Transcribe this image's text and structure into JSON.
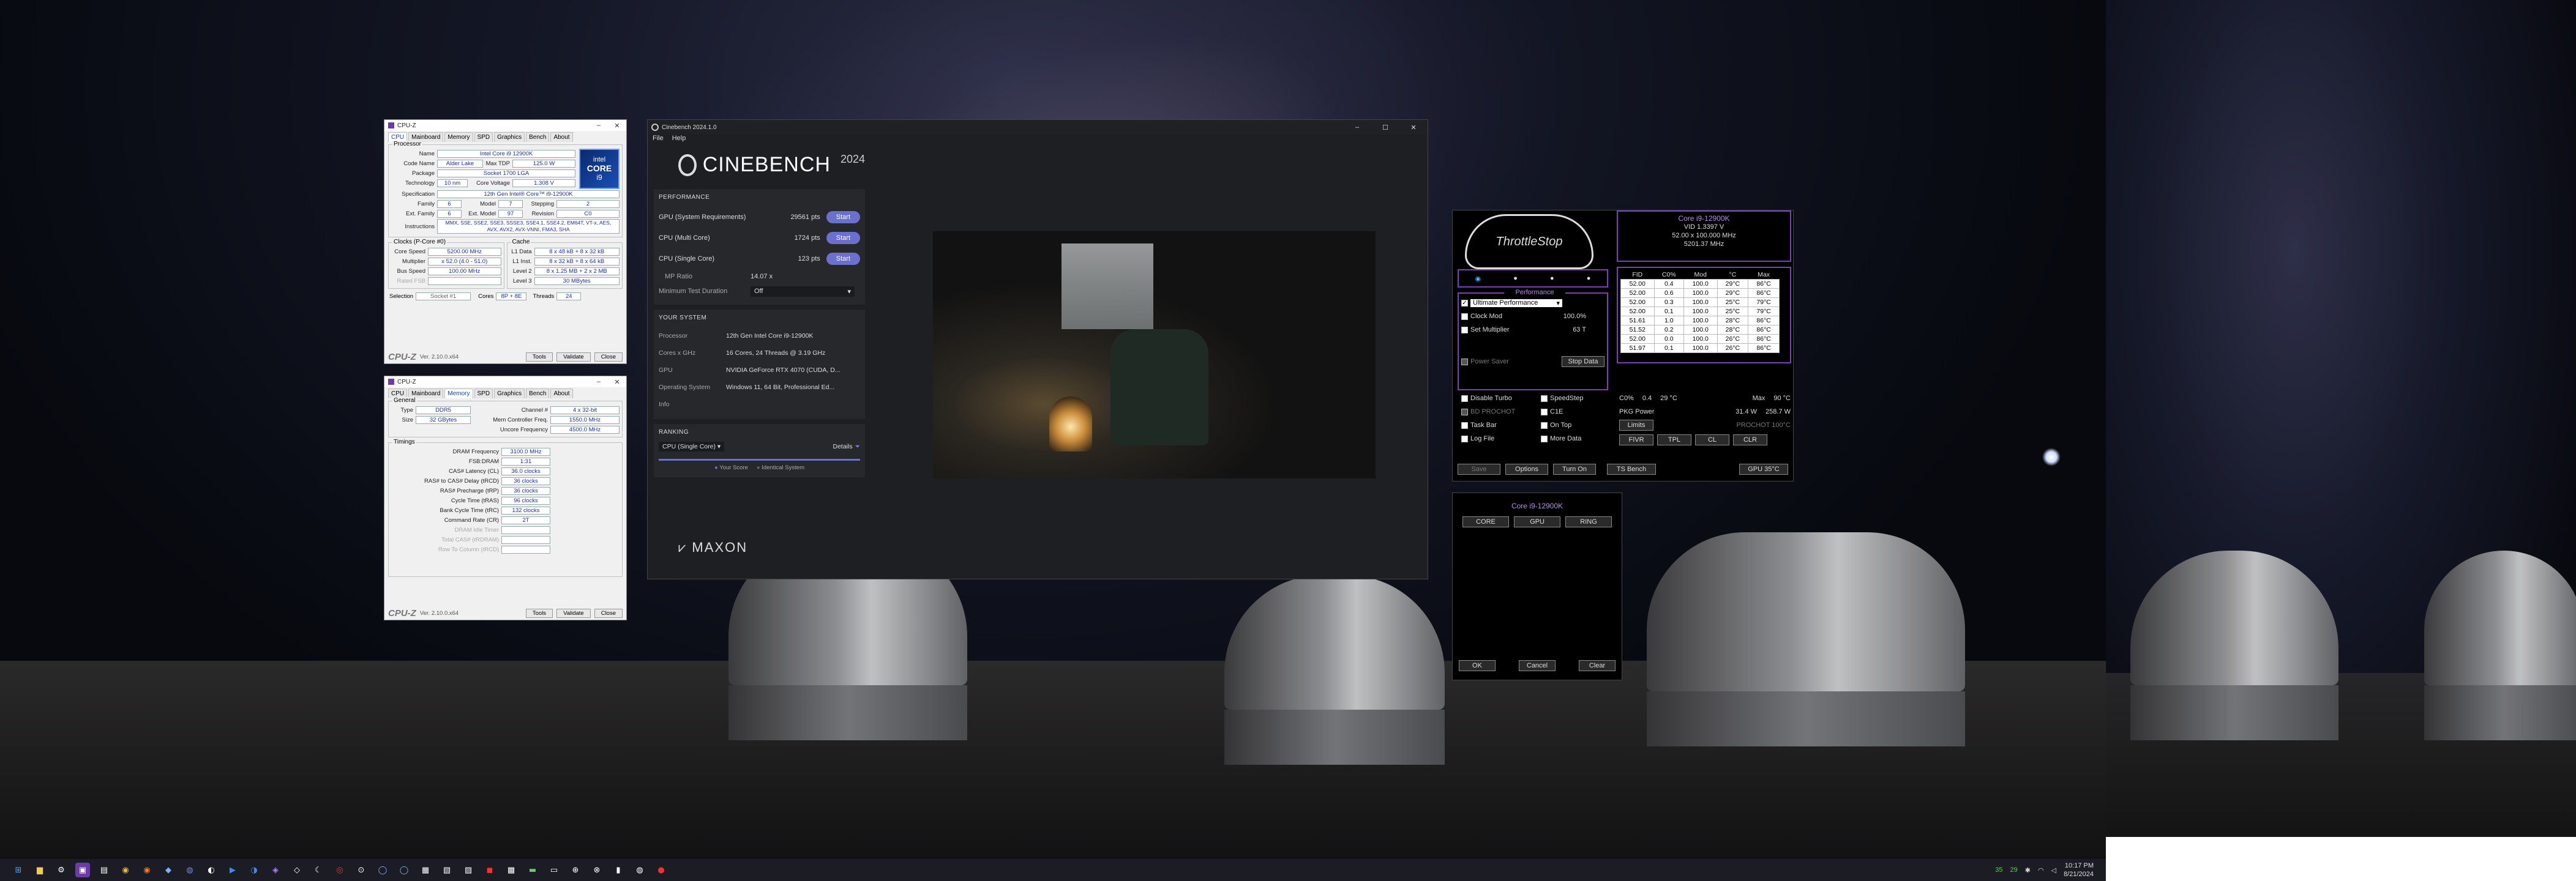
{
  "cpuz1": {
    "title": "CPU-Z",
    "tabs": [
      "CPU",
      "Mainboard",
      "Memory",
      "SPD",
      "Graphics",
      "Bench",
      "About"
    ],
    "processor_group": "Processor",
    "name_label": "Name",
    "name": "Intel Core i9 12900K",
    "codename_label": "Code Name",
    "codename": "Alder Lake",
    "maxtdp_label": "Max TDP",
    "maxtdp": "125.0 W",
    "package_label": "Package",
    "package": "Socket 1700 LGA",
    "technology_label": "Technology",
    "technology": "10 nm",
    "corevoltage_label": "Core Voltage",
    "corevoltage": "1.308 V",
    "spec_label": "Specification",
    "spec": "12th Gen Intel® Core™ i9-12900K",
    "family_label": "Family",
    "family": "6",
    "model_label": "Model",
    "model": "7",
    "stepping_label": "Stepping",
    "stepping": "2",
    "extfamily_label": "Ext. Family",
    "extfamily": "6",
    "extmodel_label": "Ext. Model",
    "extmodel": "97",
    "revision_label": "Revision",
    "revision": "C0",
    "instructions_label": "Instructions",
    "instructions": "MMX, SSE, SSE2, SSE3, SSSE3, SSE4.1, SSE4.2, EM64T, VT-x, AES, AVX, AVX2, AVX-VNNI, FMA3, SHA",
    "clocks_group": "Clocks (P-Core #0)",
    "cache_group": "Cache",
    "corespeed_label": "Core Speed",
    "corespeed": "5200.00 MHz",
    "multiplier_label": "Multiplier",
    "multiplier": "x 52.0 (4.0 - 51.0)",
    "busspeed_label": "Bus Speed",
    "busspeed": "100.00 MHz",
    "ratedfsb_label": "Rated FSB",
    "l1d_label": "L1 Data",
    "l1d": "8 x 48 kB + 8 x 32 kB",
    "l1i_label": "L1 Inst.",
    "l1i": "8 x 32 kB + 8 x 64 kB",
    "l2_label": "Level 2",
    "l2": "8 x 1.25 MB + 2 x 2 MB",
    "l3_label": "Level 3",
    "l3": "30 MBytes",
    "selection_label": "Selection",
    "selection": "Socket #1",
    "cores_label": "Cores",
    "cores": "8P + 8E",
    "threads_label": "Threads",
    "threads": "24",
    "logo_intel": "intel",
    "logo_core": "CORE",
    "logo_i9": "i9",
    "footer_brand": "CPU-Z",
    "version": "Ver. 2.10.0.x64",
    "tools": "Tools",
    "validate": "Validate",
    "close": "Close"
  },
  "cpuz2": {
    "title": "CPU-Z",
    "tabs": [
      "CPU",
      "Mainboard",
      "Memory",
      "SPD",
      "Graphics",
      "Bench",
      "About"
    ],
    "general_group": "General",
    "type_label": "Type",
    "type": "DDR5",
    "channel_label": "Channel #",
    "channel": "4 x 32-bit",
    "size_label": "Size",
    "size": "32 GBytes",
    "memctrl_label": "Mem Controller Freq.",
    "memctrl": "1550.0 MHz",
    "uncore_label": "Uncore Frequency",
    "uncore": "4500.0 MHz",
    "timings_group": "Timings",
    "dramfreq_label": "DRAM Frequency",
    "dramfreq": "3100.0 MHz",
    "fsbdram_label": "FSB:DRAM",
    "fsbdram": "1:31",
    "cl_label": "CAS# Latency (CL)",
    "cl": "36.0 clocks",
    "trcd_label": "RAS# to CAS# Delay (tRCD)",
    "trcd": "36 clocks",
    "trp_label": "RAS# Precharge (tRP)",
    "trp": "36 clocks",
    "tras_label": "Cycle Time (tRAS)",
    "tras": "96 clocks",
    "trc_label": "Bank Cycle Time (tRC)",
    "trc": "132 clocks",
    "cr_label": "Command Rate (CR)",
    "cr": "2T",
    "idle_label": "DRAM Idle Timer",
    "trdram_label": "Total CAS# (tRDRAM)",
    "trcdr_label": "Row To Column (tRCD)",
    "footer_brand": "CPU-Z",
    "version": "Ver. 2.10.0.x64",
    "tools": "Tools",
    "validate": "Validate",
    "close": "Close"
  },
  "cinebench": {
    "title": "Cinebench 2024.1.0",
    "menu": [
      "File",
      "Help"
    ],
    "logo_text": "CINEBENCH",
    "logo_year": "2024",
    "performance_title": "PERFORMANCE",
    "gpu_label": "GPU (System Requirements)",
    "gpu_score": "29561 pts",
    "multi_label": "CPU (Multi Core)",
    "multi_score": "1724 pts",
    "single_label": "CPU (Single Core)",
    "single_score": "123 pts",
    "mp_label": "MP Ratio",
    "mp_value": "14.07 x",
    "duration_label": "Minimum Test Duration",
    "duration_value": "Off",
    "start": "Start",
    "system_title": "YOUR SYSTEM",
    "processor_label": "Processor",
    "processor": "12th Gen Intel Core i9-12900K",
    "cores_label": "Cores x GHz",
    "cores": "16 Cores, 24 Threads @ 3.19 GHz",
    "gpu_sys_label": "GPU",
    "gpu_sys": "NVIDIA GeForce RTX 4070 (CUDA, D...",
    "os_label": "Operating System",
    "os": "Windows 11, 64 Bit, Professional Ed...",
    "info_label": "Info",
    "ranking_title": "RANKING",
    "ranking_select": "CPU (Single Core)",
    "details": "Details",
    "your_score": "Your Score",
    "identical": "Identical System",
    "maxon": "MAXON"
  },
  "oc": {
    "cpu_name": "Core i9-12900K",
    "vid": "VID  1.3397 V",
    "mult": "52.00 x 100.000 MHz",
    "freq": "5201.37 MHz",
    "table_headers": [
      "FID",
      "C0%",
      "Mod",
      "°C",
      "Max"
    ],
    "table_rows": [
      [
        "52.00",
        "0.4",
        "100.0",
        "29°C",
        "86°C"
      ],
      [
        "52.00",
        "0.6",
        "100.0",
        "29°C",
        "86°C"
      ],
      [
        "52.00",
        "0.3",
        "100.0",
        "25°C",
        "79°C"
      ],
      [
        "52.00",
        "0.1",
        "100.0",
        "25°C",
        "79°C"
      ],
      [
        "51.61",
        "1.0",
        "100.0",
        "28°C",
        "86°C"
      ],
      [
        "51.52",
        "0.2",
        "100.0",
        "28°C",
        "86°C"
      ],
      [
        "52.00",
        "0.0",
        "100.0",
        "26°C",
        "86°C"
      ],
      [
        "51.97",
        "0.1",
        "100.0",
        "26°C",
        "86°C"
      ]
    ],
    "c0_label": "C0%",
    "c0_val": "0.4",
    "temp_val": "29 °C",
    "max_label": "Max",
    "max_val": "90 °C",
    "pkg_label": "PKG Power",
    "pkg_val": "31.4 W",
    "pkg_max": "258.7 W",
    "limits": "Limits",
    "prochot": "PROCHOT 100°C",
    "performance": "Performance",
    "profile": "Ultimate Performance",
    "clock_mod": "Clock Mod",
    "clock_mod_val": "100.0%",
    "set_mult": "Set Multiplier",
    "set_mult_val": "63 T",
    "power_saver": "Power Saver",
    "stop_data": "Stop Data",
    "disable_turbo": "Disable Turbo",
    "speedstep": "SpeedStep",
    "bd_prochot": "BD PROCHOT",
    "c1e": "C1E",
    "task_bar": "Task Bar",
    "on_top": "On Top",
    "log_file": "Log File",
    "more_data": "More Data",
    "fivr": "FIVR",
    "tpl": "TPL",
    "cl": "CL",
    "clr": "CLR",
    "save": "Save",
    "options": "Options",
    "turn_on": "Turn On",
    "ts_bench": "TS Bench",
    "gpu_temp": "GPU 35°C",
    "logo_text": "ThrottleStop"
  },
  "oc2": {
    "cpu_name": "Core i9-12900K",
    "core": "CORE",
    "gpu": "GPU",
    "ring": "RING",
    "ok": "OK",
    "cancel": "Cancel",
    "clear": "Clear"
  },
  "taskbar": {
    "time": "10:17 PM",
    "date": "8/21/2024",
    "temp1": "35",
    "temp2": "29"
  }
}
